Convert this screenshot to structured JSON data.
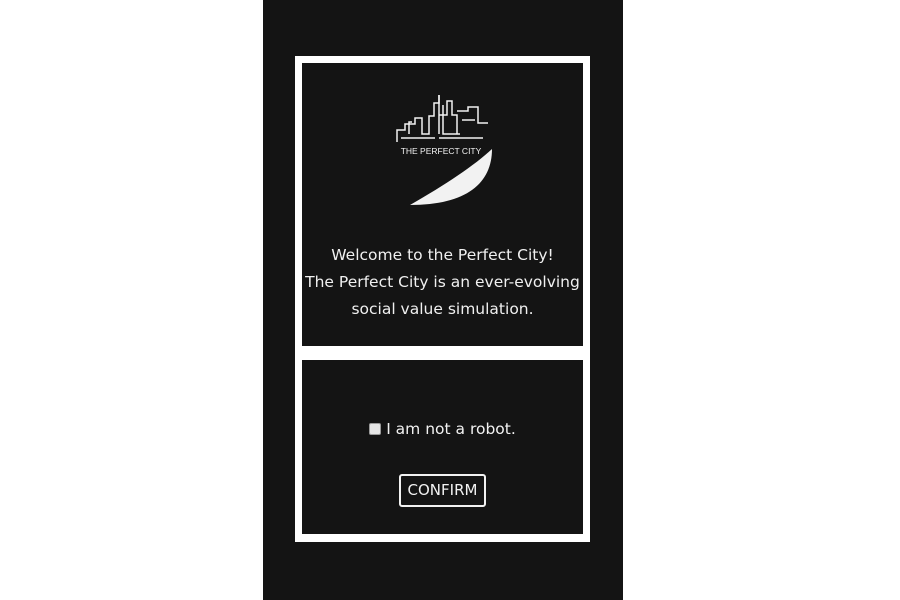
{
  "logo": {
    "text": "THE PERFECT CITY",
    "icon": "city-skyline-moon-logo"
  },
  "welcome": {
    "line1": "Welcome to the Perfect City!",
    "line2": "The Perfect City is an ever-evolving",
    "line3": "social value simulation."
  },
  "captcha": {
    "checkbox_checked": false,
    "label": "I am not a robot."
  },
  "confirm_button": {
    "label": "CONFIRM"
  },
  "colors": {
    "background": "#141414",
    "foreground": "#f0f0f0",
    "page": "#ffffff"
  }
}
